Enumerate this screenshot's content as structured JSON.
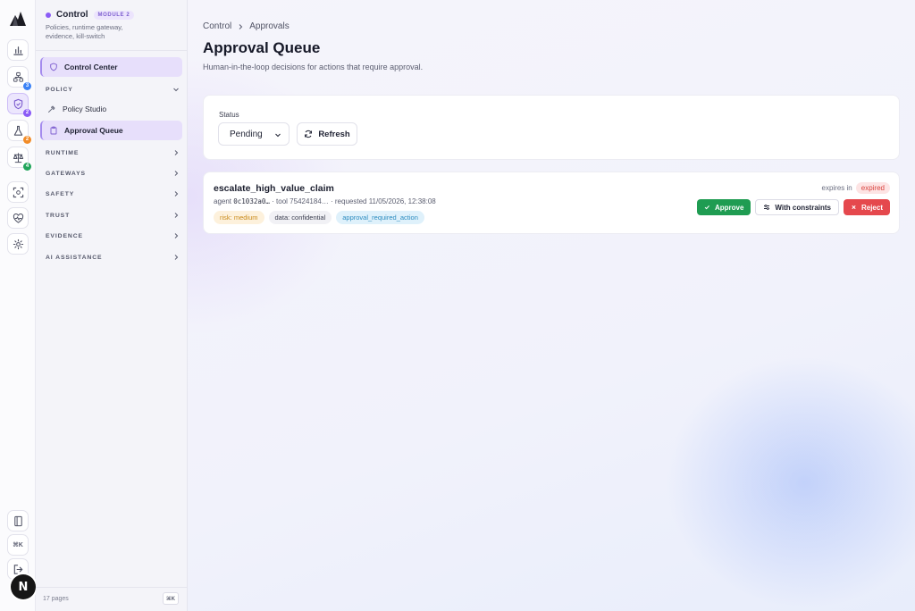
{
  "rail": {
    "badges": [
      "3",
      "2",
      "2",
      "4"
    ],
    "badge_colors": [
      "#3b82f6",
      "#8b5cf6",
      "#f28c28",
      "#22a55b"
    ],
    "kbd": "⌘K",
    "avatar": "N"
  },
  "sidebar": {
    "title": "Control",
    "module": "MODULE 2",
    "description": "Policies, runtime gateway, evidence, kill-switch",
    "control_center": "Control Center",
    "policy_section": "POLICY",
    "policy_studio": "Policy Studio",
    "approval_queue": "Approval Queue",
    "sections": [
      "RUNTIME",
      "GATEWAYS",
      "SAFETY",
      "TRUST",
      "EVIDENCE",
      "AI ASSISTANCE"
    ],
    "pages_count": "17 pages",
    "kbd": "⌘K"
  },
  "main": {
    "breadcrumb": [
      "Control",
      "Approvals"
    ],
    "title": "Approval Queue",
    "subtitle": "Human-in-the-loop decisions for actions that require approval.",
    "filter": {
      "status_label": "Status",
      "status_value": "Pending",
      "refresh_label": "Refresh"
    },
    "approval": {
      "name": "escalate_high_value_claim",
      "agent_label": "agent",
      "agent_id": "0c1032a0…",
      "tool_label": "· tool",
      "tool_id": "75424184…",
      "requested": "· requested 11/05/2026, 12:38:08",
      "tags": [
        "risk: medium",
        "data: confidential",
        "approval_required_action"
      ],
      "expires_label": "expires in",
      "expires_value": "expired",
      "approve_label": "Approve",
      "constraints_label": "With constraints",
      "reject_label": "Reject"
    }
  }
}
